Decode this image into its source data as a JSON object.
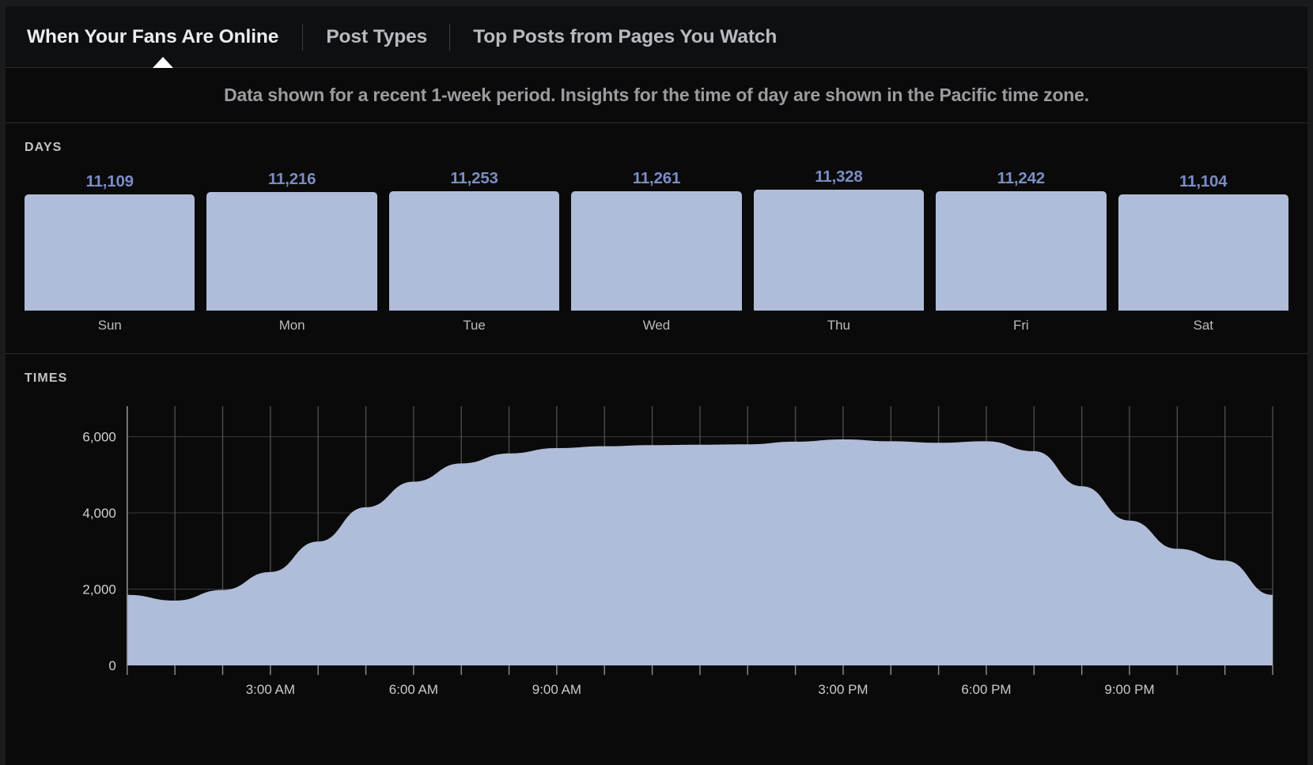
{
  "window": {
    "frame_color": "#1a1b1d",
    "background": "#0a0a0a"
  },
  "tabs": [
    {
      "label": "When Your Fans Are Online",
      "active": true
    },
    {
      "label": "Post Types",
      "active": false
    },
    {
      "label": "Top Posts from Pages You Watch",
      "active": false
    }
  ],
  "subtitle": "Data shown for a recent 1-week period. Insights for the time of day are shown in the Pacific time zone.",
  "days_section": {
    "label": "DAYS"
  },
  "times_section": {
    "label": "TIMES"
  },
  "colors": {
    "series_fill": "#b0bdd9",
    "value_label": "#7b8dc4",
    "gridline": "#4a4b4d",
    "axis": "#8d8f92",
    "text_primary": "#ebedef",
    "text_secondary": "#b7bbc0",
    "divider": "#2b2c2e"
  },
  "chart_data": [
    {
      "type": "bar",
      "title": "DAYS",
      "xlabel": "",
      "ylabel": "",
      "categories": [
        "Sun",
        "Mon",
        "Tue",
        "Wed",
        "Thu",
        "Fri",
        "Sat"
      ],
      "values": [
        11109,
        11216,
        11253,
        11261,
        11328,
        11242,
        11104
      ],
      "value_labels": [
        "11,109",
        "11,216",
        "11,253",
        "11,261",
        "11,328",
        "11,242",
        "11,104"
      ],
      "ylim": [
        0,
        11328
      ],
      "grid": false,
      "legend": "none"
    },
    {
      "type": "area",
      "title": "TIMES",
      "xlabel": "",
      "ylabel": "",
      "ylim": [
        0,
        6800
      ],
      "yticks": [
        0,
        2000,
        4000,
        6000
      ],
      "ytick_labels": [
        "0",
        "2,000",
        "4,000",
        "6,000"
      ],
      "grid": true,
      "legend": "none",
      "x": [
        "12:00 AM",
        "1:00 AM",
        "2:00 AM",
        "3:00 AM",
        "4:00 AM",
        "5:00 AM",
        "6:00 AM",
        "7:00 AM",
        "8:00 AM",
        "9:00 AM",
        "10:00 AM",
        "11:00 AM",
        "12:00 PM",
        "1:00 PM",
        "2:00 PM",
        "3:00 PM",
        "4:00 PM",
        "5:00 PM",
        "6:00 PM",
        "7:00 PM",
        "8:00 PM",
        "9:00 PM",
        "10:00 PM",
        "11:00 PM"
      ],
      "xtick_labels": [
        "",
        "",
        "",
        "3:00 AM",
        "",
        "",
        "6:00 AM",
        "",
        "",
        "9:00 AM",
        "",
        "",
        "",
        "",
        "",
        "3:00 PM",
        "",
        "",
        "6:00 PM",
        "",
        "",
        "9:00 PM",
        "",
        ""
      ],
      "values": [
        1850,
        1700,
        1980,
        2450,
        3250,
        4150,
        4820,
        5300,
        5560,
        5700,
        5750,
        5780,
        5790,
        5800,
        5870,
        5930,
        5880,
        5840,
        5880,
        5620,
        4700,
        3800,
        3060,
        2750,
        1850
      ]
    }
  ]
}
